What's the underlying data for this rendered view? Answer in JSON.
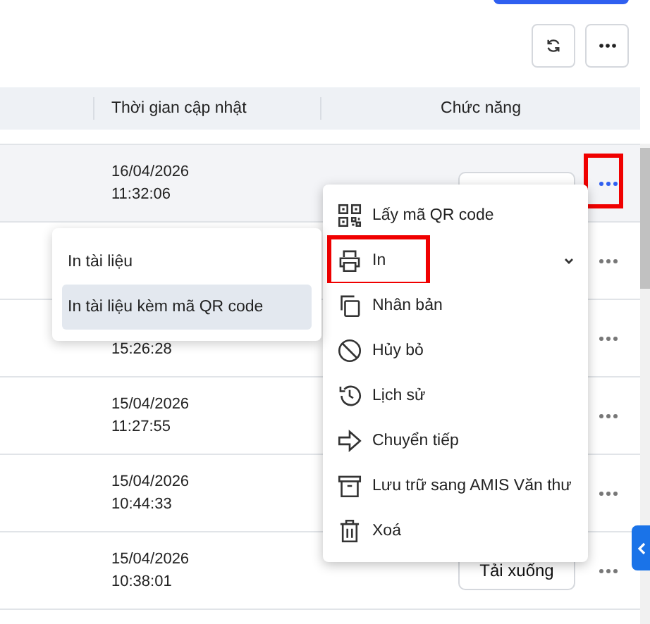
{
  "toolbar": {
    "buttons": [
      {
        "kind": "refresh"
      },
      {
        "kind": "more"
      }
    ]
  },
  "table": {
    "columns": [
      {
        "label": "Thời gian cập nhật"
      },
      {
        "label": "Chức năng"
      }
    ],
    "rows": [
      {
        "date": "16/04/2026",
        "time": "11:32:06",
        "download_button": true,
        "hovered": true,
        "menu_open": true,
        "highlighted": true
      },
      {
        "hovered": false,
        "menu_open": false,
        "highlighted": false
      },
      {
        "time": "15:26:28",
        "hovered": false,
        "menu_open": false,
        "highlighted": false
      },
      {
        "date": "15/04/2026",
        "time": "11:27:55",
        "hovered": false,
        "menu_open": false,
        "highlighted": false
      },
      {
        "date": "15/04/2026",
        "time": "10:44:33",
        "hovered": false,
        "menu_open": false,
        "highlighted": false
      },
      {
        "date": "15/04/2026",
        "time": "10:38:01",
        "download_button": true,
        "action": "Tải xuống",
        "hovered": false,
        "menu_open": false,
        "highlighted": false
      }
    ]
  },
  "context_menu": {
    "items": [
      {
        "kind": "qr",
        "label": "Lấy mã QR code",
        "submenu": false,
        "highlighted": false
      },
      {
        "kind": "printer",
        "label": "In",
        "submenu": true,
        "highlighted": true
      },
      {
        "kind": "copy",
        "label": "Nhân bản",
        "submenu": false,
        "highlighted": false
      },
      {
        "kind": "cancel",
        "label": "Hủy bỏ",
        "submenu": false,
        "highlighted": false
      },
      {
        "kind": "history",
        "label": "Lịch sử",
        "submenu": false,
        "highlighted": false
      },
      {
        "kind": "forward",
        "label": "Chuyển tiếp",
        "submenu": false,
        "highlighted": false
      },
      {
        "kind": "archive",
        "label": "Lưu trữ sang AMIS Văn thư",
        "submenu": false,
        "highlighted": false
      },
      {
        "kind": "trash",
        "label": "Xoá",
        "submenu": false,
        "highlighted": false
      }
    ]
  },
  "submenu": {
    "items": [
      {
        "label": "In tài liệu",
        "selected": false
      },
      {
        "label": "In tài liệu kèm mã QR code",
        "selected": true
      }
    ]
  }
}
